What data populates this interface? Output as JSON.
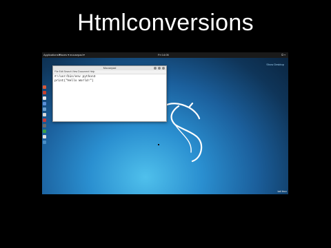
{
  "banner": {
    "title": "Htmlconversions"
  },
  "desktop": {
    "topbar": {
      "applications": "Applications ▾",
      "places": "Places ▾",
      "active_app": "mousepad ▾",
      "clock": "Fri 14:05"
    },
    "corner_label": "Show Desktop",
    "brand": "kali linux"
  },
  "editor": {
    "window_title": "Mousepad",
    "menu": "File  Edit  Search  View  Document  Help",
    "code_line1": "#!/usr/bin/env python3",
    "code_line2": "",
    "code_line3": "print(\"Hello World!\")"
  },
  "dock_icons": [
    "#d75a3a",
    "#c8402e",
    "#e8e8e8",
    "#5a8fd8",
    "#6aa0d0",
    "#d8d8d8",
    "#c43c3c",
    "#6a6a6a",
    "#3aa04a",
    "#e0e0e0",
    "#4a8fc8"
  ]
}
